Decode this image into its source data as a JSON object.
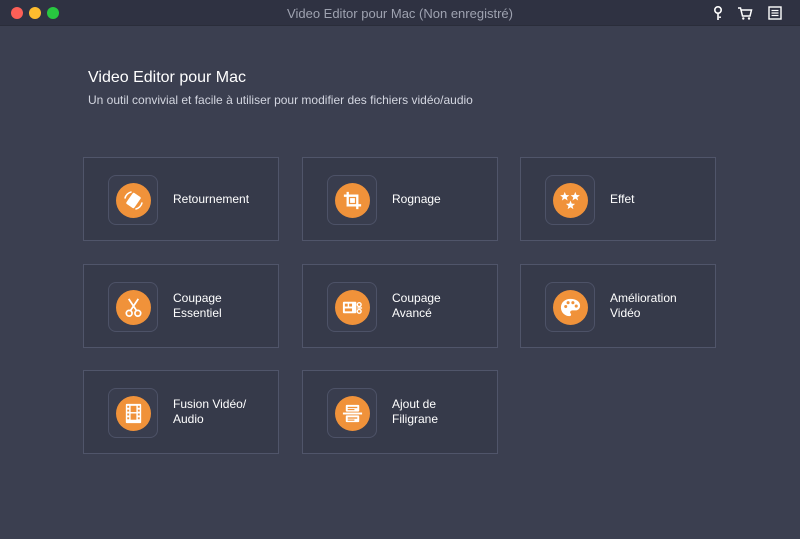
{
  "window": {
    "title": "Video Editor pour Mac (Non enregistré)"
  },
  "toolbar_icons": [
    "key-icon",
    "cart-icon",
    "menu-icon"
  ],
  "header": {
    "title": "Video Editor pour Mac",
    "subtitle": "Un outil convivial et facile à utiliser pour modifier des fichiers vidéo/audio"
  },
  "colors": {
    "accent": "#f0923a",
    "background": "#3b3f50",
    "card": "#363a4a"
  },
  "tools": [
    {
      "label": "Retournement",
      "icon": "rotate-icon"
    },
    {
      "label": "Rognage",
      "icon": "crop-icon"
    },
    {
      "label": "Effet",
      "icon": "stars-icon"
    },
    {
      "label": "Coupage\nEssentiel",
      "icon": "scissors-icon"
    },
    {
      "label": "Coupage\nAvancé",
      "icon": "advanced-cut-icon"
    },
    {
      "label": "Amélioration\nVidéo",
      "icon": "palette-icon"
    },
    {
      "label": "Fusion Vidéo/\nAudio",
      "icon": "film-merge-icon"
    },
    {
      "label": "Ajout de\nFiligrane",
      "icon": "watermark-icon"
    }
  ]
}
